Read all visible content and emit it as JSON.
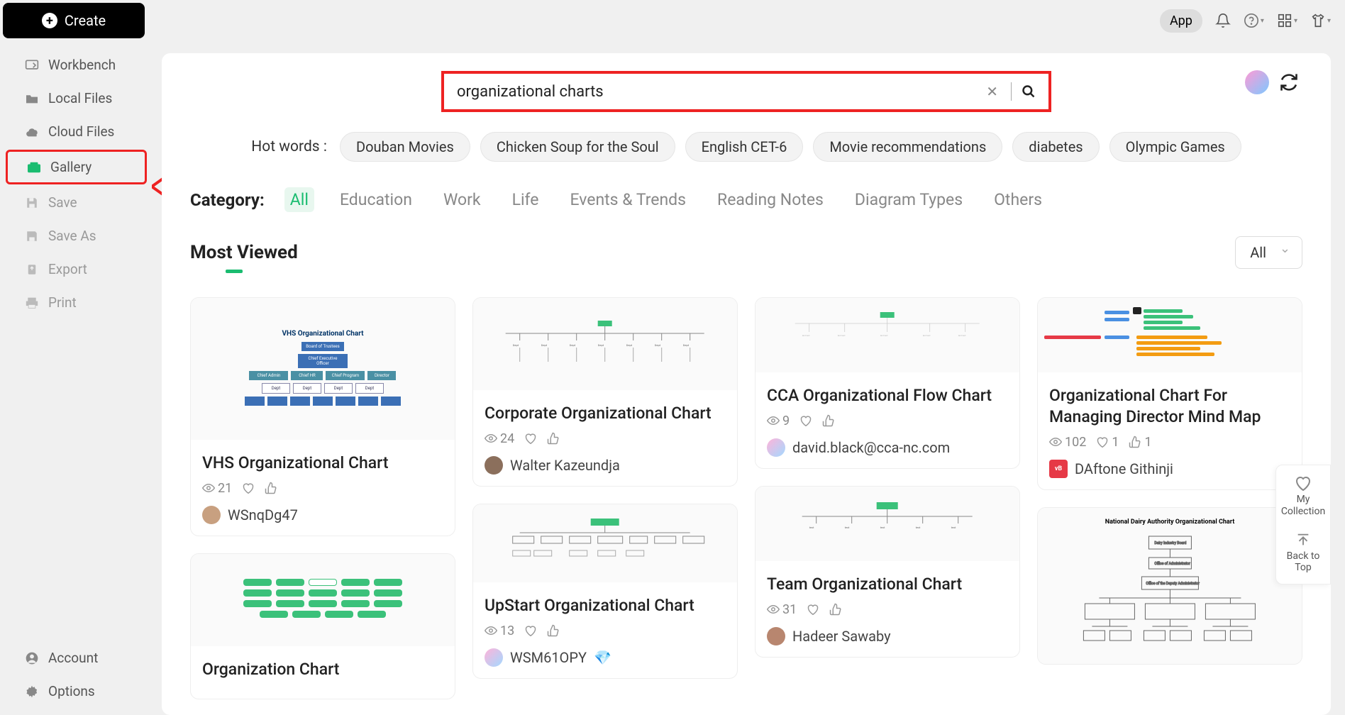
{
  "create_label": "Create",
  "sidebar": {
    "workbench": "Workbench",
    "local_files": "Local Files",
    "cloud_files": "Cloud Files",
    "gallery": "Gallery",
    "save": "Save",
    "save_as": "Save As",
    "export": "Export",
    "print": "Print",
    "account": "Account",
    "options": "Options"
  },
  "topbar": {
    "app": "App"
  },
  "search": {
    "value": "organizational charts"
  },
  "hotwords": {
    "label": "Hot words :",
    "items": [
      "Douban Movies",
      "Chicken Soup for the Soul",
      "English CET-6",
      "Movie recommendations",
      "diabetes",
      "Olympic Games"
    ]
  },
  "category": {
    "label": "Category:",
    "tabs": [
      "All",
      "Education",
      "Work",
      "Life",
      "Events & Trends",
      "Reading Notes",
      "Diagram Types",
      "Others"
    ]
  },
  "section": {
    "title": "Most Viewed",
    "sort": "All"
  },
  "cards": [
    {
      "title": "VHS Organizational Chart",
      "views": "21",
      "author": "WSnqDg47"
    },
    {
      "title": "Corporate Organizational Chart",
      "views": "24",
      "author": "Walter Kazeundja"
    },
    {
      "title": "CCA Organizational Flow Chart",
      "views": "9",
      "author": "david.black@cca-nc.com"
    },
    {
      "title": "Organizational Chart For Managing Director Mind Map",
      "views": "102",
      "likes": "1",
      "thumbs": "1",
      "author": "DAftone Githinji"
    },
    {
      "title": "Organization Chart",
      "author": ""
    },
    {
      "title": "UpStart Organizational Chart",
      "views": "13",
      "author": "WSM61OPY"
    },
    {
      "title": "Team Organizational Chart",
      "views": "31",
      "author": "Hadeer Sawaby"
    }
  ],
  "right_panel": {
    "my_collection": "My Collection",
    "back_to_top": "Back to Top"
  },
  "thumb_labels": {
    "vhs_title": "VHS Organizational Chart",
    "nda_title": "National Dairy Authority Organizational Chart"
  }
}
